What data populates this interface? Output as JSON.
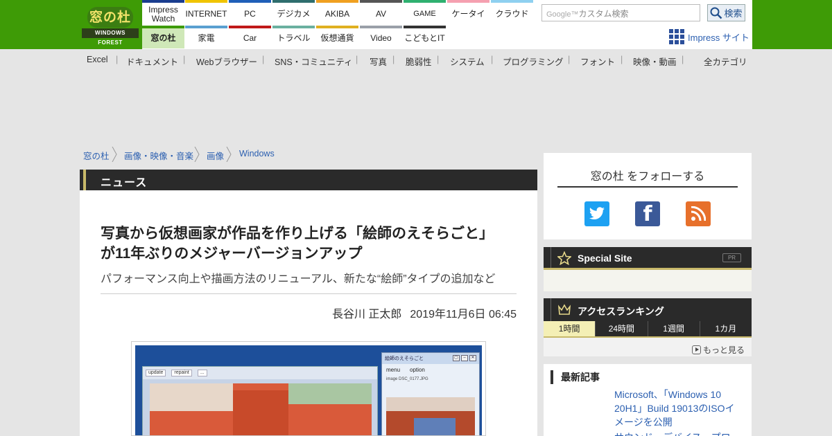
{
  "header": {
    "logo_jp": "窓の杜",
    "logo_en": "WINDOWS FOREST",
    "sites_top": [
      {
        "label": "Impress\nWatch",
        "color": "#1a3d8f"
      },
      {
        "label": "INTERNET",
        "color": "#f0c400"
      },
      {
        "label": "PC",
        "color": "#1f5fb8"
      },
      {
        "label": "デジカメ",
        "color": "#2f6e6e"
      },
      {
        "label": "AKIBA",
        "color": "#f0a020"
      },
      {
        "label": "AV",
        "color": "#555555"
      },
      {
        "label": "GAME",
        "color": "#2fb070"
      },
      {
        "label": "ケータイ",
        "color": "#f5a0b0"
      },
      {
        "label": "クラウド",
        "color": "#8fd0f0"
      }
    ],
    "sites_bottom": [
      {
        "label": "窓の杜",
        "color": "#3e9b06",
        "active": true
      },
      {
        "label": "家電",
        "color": "#5aa0d0"
      },
      {
        "label": "Car",
        "color": "#c01818"
      },
      {
        "label": "トラベル",
        "color": "#6ab0a0"
      },
      {
        "label": "仮想通貨",
        "color": "#e0b020"
      },
      {
        "label": "Video",
        "color": "#9aa0a8"
      },
      {
        "label": "こどもとIT",
        "color": "#333333"
      }
    ],
    "search_placeholder": "カスタム検索",
    "search_google": "Google™",
    "search_button": "検索",
    "impress_site": "Impress サイト"
  },
  "categories": [
    "Excel",
    "ドキュメント",
    "Webブラウザー",
    "SNS・コミュニティ",
    "写真",
    "脆弱性",
    "システム",
    "プログラミング",
    "フォント",
    "映像・動画"
  ],
  "all_categories": "全カテゴリ",
  "breadcrumb": [
    "窓の杜",
    "画像・映像・音楽",
    "画像",
    "Windows"
  ],
  "article": {
    "section": "ニュース",
    "title_line1": "写真から仮想画家が作品を作り上げる「絵師のえそらごと」",
    "title_line2": "が11年ぶりのメジャーバージョンアップ",
    "subtitle": "パフォーマンス向上や描画方法のリニューアル、新たな“絵師”タイプの追加など",
    "author": "長谷川 正太郎",
    "date": "2019年11月6日 06:45",
    "screenshot": {
      "main_buttons": [
        "update",
        "repaint",
        "..."
      ],
      "win_title": "絵師のえそらごと",
      "menu": [
        "menu",
        "option"
      ],
      "image_row": "image   DSC_0177.JPG"
    }
  },
  "sidebar": {
    "follow_title": "窓の杜 をフォローする",
    "social": [
      "twitter-icon",
      "facebook-icon",
      "rss-icon"
    ],
    "special_title": "Special Site",
    "pr": "PR",
    "ranking_title": "アクセスランキング",
    "ranking_tabs": [
      "1時間",
      "24時間",
      "1週間",
      "1カ月"
    ],
    "ranking_active": 0,
    "more": "もっと見る",
    "latest_title": "最新記事",
    "latest_link": "Microsoft、「Windows 10 20H1」Build 19013のISOイメージを公開",
    "latest_link2": "サウンド・デバイス・プロ"
  }
}
